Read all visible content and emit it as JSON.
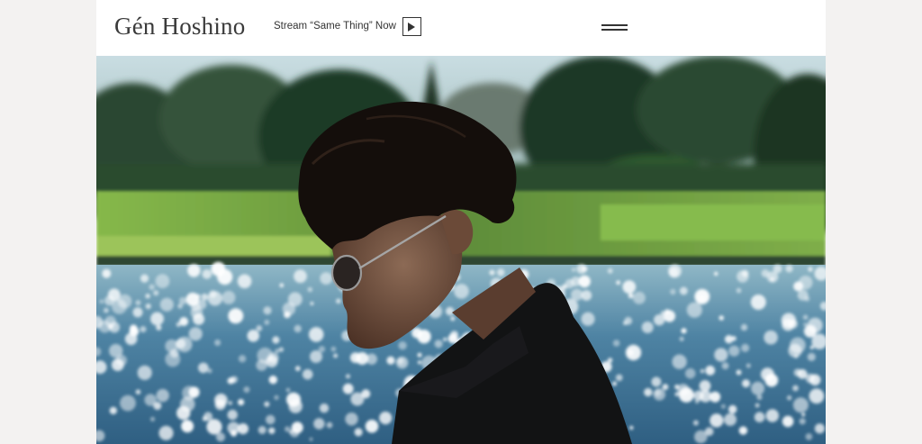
{
  "header": {
    "logo": "Gén Hoshino",
    "stream_text": "Stream “Same Thing” Now",
    "play_icon": "play-icon",
    "menu_icon": "hamburger-menu-icon"
  },
  "hero": {
    "description_icon": "hero-photo",
    "colors": {
      "sky": "#b7cfd6",
      "trees": "#24402a",
      "grass": "#7fb14a",
      "water": "#3d6f93",
      "sparkle": "#ffffff",
      "hair": "#140f0c",
      "skin": "#7a5a48",
      "jacket": "#111213"
    }
  }
}
